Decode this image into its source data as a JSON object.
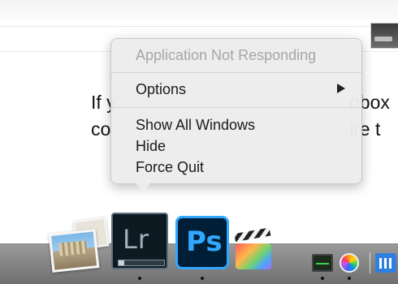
{
  "document": {
    "line1_start": "If y",
    "line1_end": "obox",
    "line2_start": "co",
    "line2_end": "ire t"
  },
  "context_menu": {
    "title": "Application Not Responding",
    "options_label": "Options",
    "show_all_windows_label": "Show All Windows",
    "hide_label": "Hide",
    "force_quit_label": "Force Quit"
  },
  "dock": {
    "apps": [
      {
        "name": "Preview",
        "icon": "photo-stack-icon"
      },
      {
        "name": "Lightroom",
        "icon": "lightroom-icon",
        "text": "Lr"
      },
      {
        "name": "Photoshop",
        "icon": "photoshop-icon",
        "text": "Ps"
      },
      {
        "name": "Final Cut Pro",
        "icon": "final-cut-pro-icon"
      },
      {
        "name": "Activity Monitor",
        "icon": "activity-monitor-icon"
      },
      {
        "name": "Photos",
        "icon": "photos-icon"
      },
      {
        "name": "Keynote",
        "icon": "chart-icon"
      }
    ],
    "lightroom_progress": 0.12
  },
  "colors": {
    "photoshop_accent": "#31a8ff",
    "photoshop_bg": "#001e36",
    "lightroom_bg": "#0e1a22",
    "menu_bg": "#ececec",
    "disabled_text": "#a6a6a6"
  }
}
